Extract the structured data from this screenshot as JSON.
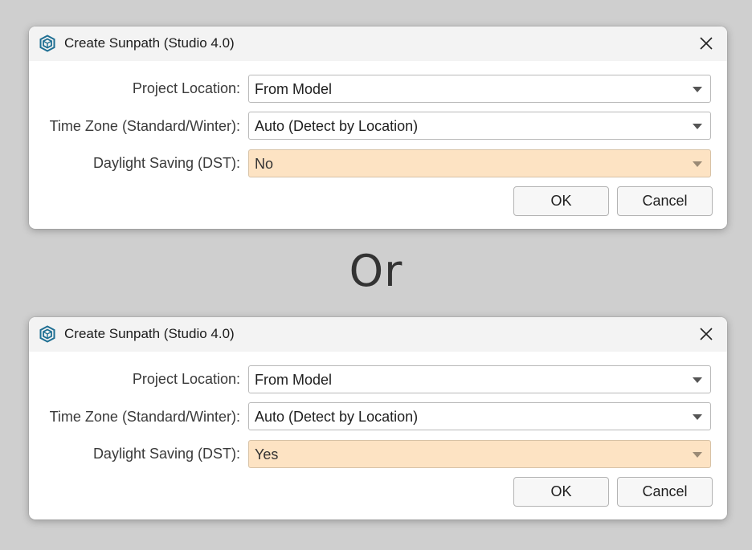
{
  "colors": {
    "background": "#cfcfcf",
    "titlebar": "#f3f3f3",
    "highlight": "#fde3c3",
    "icon": "#1f6f93"
  },
  "icons": {
    "app": "sketchup-logo-icon",
    "close": "close-icon",
    "dropdown": "chevron-down-icon"
  },
  "separator": "Or",
  "dialogs": [
    {
      "title": "Create Sunpath (Studio 4.0)",
      "fields": [
        {
          "label": "Project Location:",
          "value": "From Model"
        },
        {
          "label": "Time Zone (Standard/Winter):",
          "value": "Auto (Detect by Location)"
        },
        {
          "label": "Daylight Saving (DST):",
          "value": "No"
        }
      ],
      "buttons": {
        "ok": "OK",
        "cancel": "Cancel"
      }
    },
    {
      "title": "Create Sunpath (Studio 4.0)",
      "fields": [
        {
          "label": "Project Location:",
          "value": "From Model"
        },
        {
          "label": "Time Zone (Standard/Winter):",
          "value": "Auto (Detect by Location)"
        },
        {
          "label": "Daylight Saving (DST):",
          "value": "Yes"
        }
      ],
      "buttons": {
        "ok": "OK",
        "cancel": "Cancel"
      }
    }
  ]
}
